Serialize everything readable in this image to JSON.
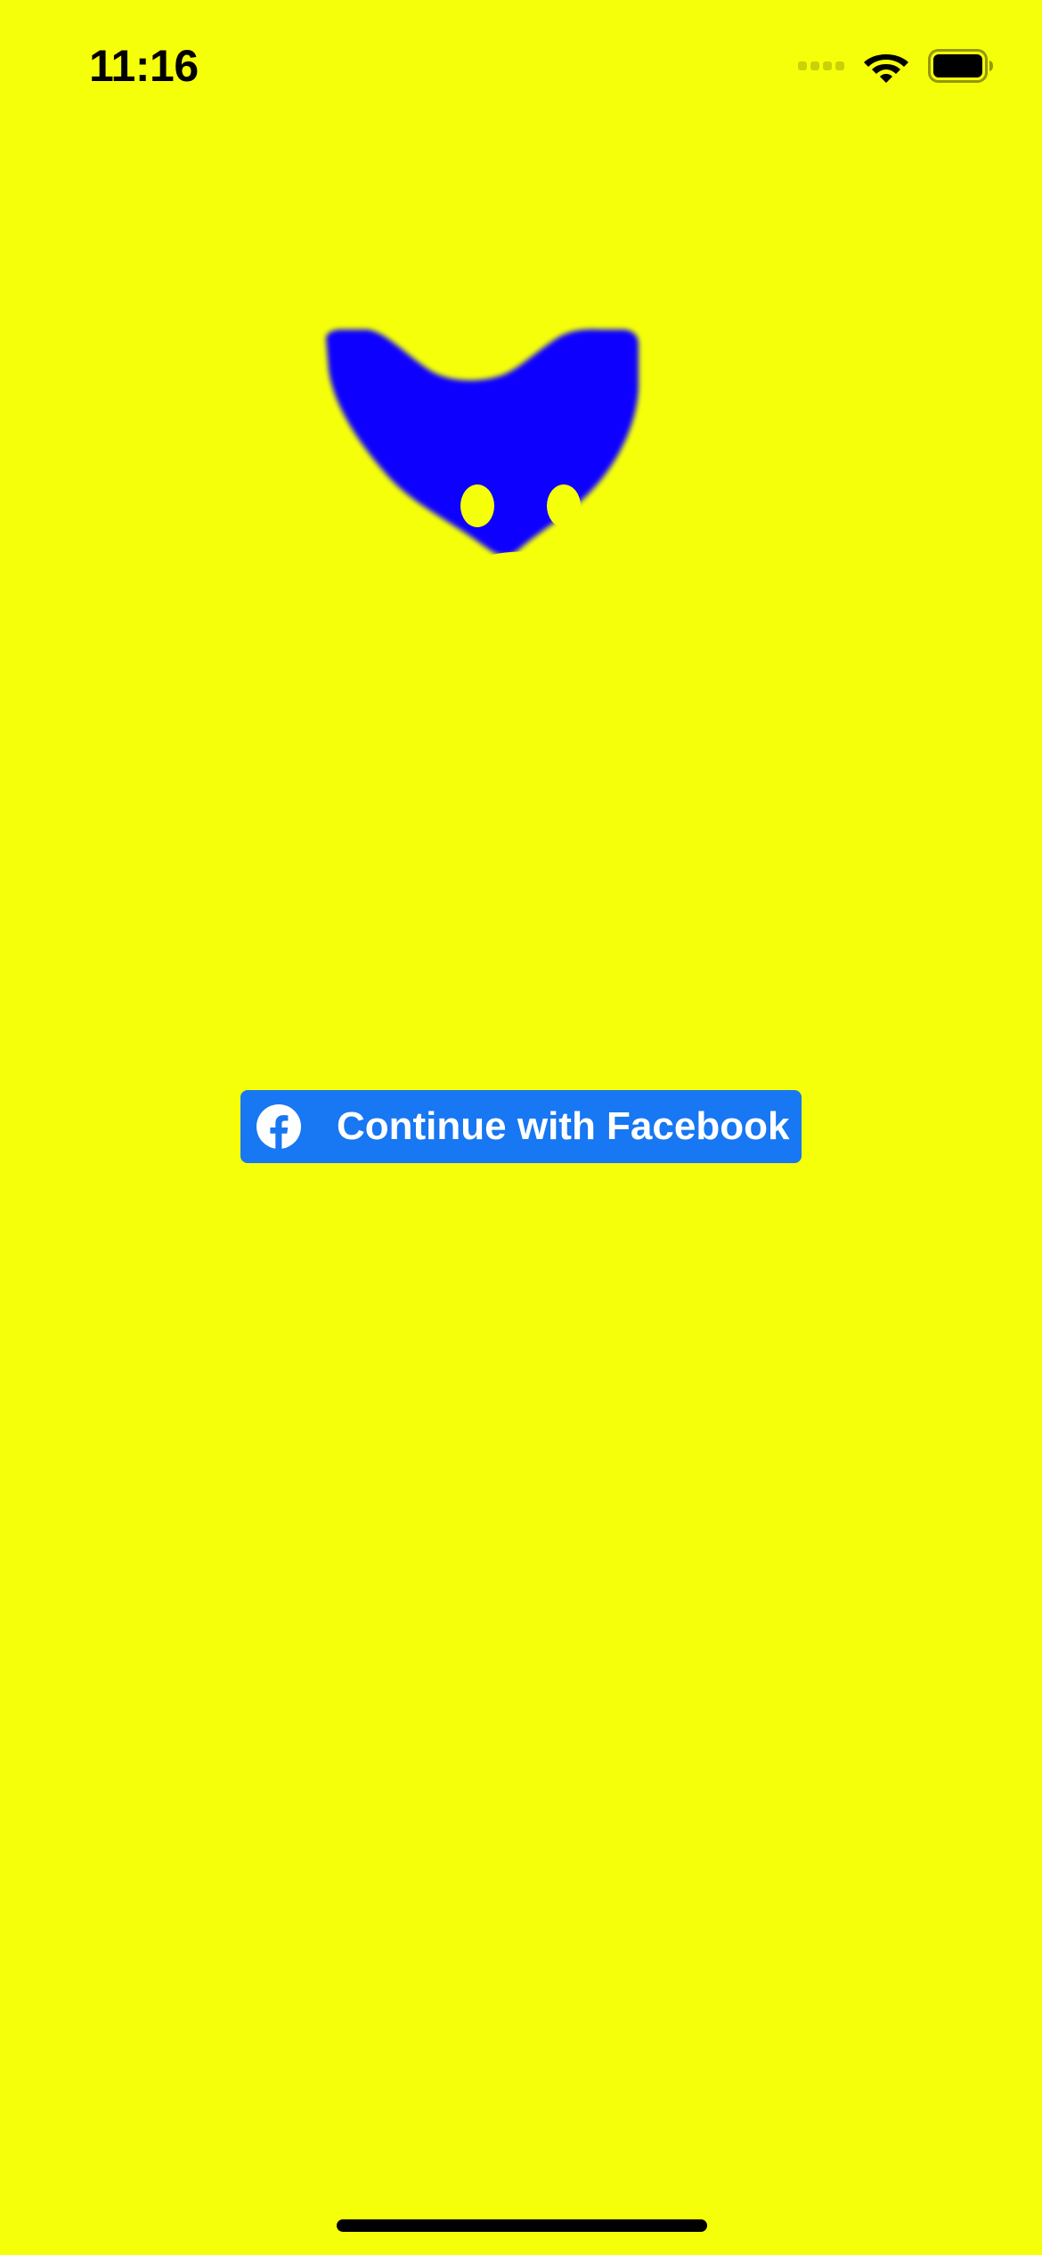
{
  "status_bar": {
    "time": "11:16",
    "signal_icon": "cellular-signal-icon",
    "wifi_icon": "wifi-icon",
    "battery_icon": "battery-icon"
  },
  "logo": {
    "icon": "mascot-heart-face-icon",
    "color": "#0A00FF"
  },
  "login": {
    "facebook_button_label": "Continue with Facebook",
    "facebook_icon": "facebook-icon",
    "button_color": "#1877F2"
  },
  "colors": {
    "background": "#F6FF0A",
    "accent": "#1877F2"
  }
}
